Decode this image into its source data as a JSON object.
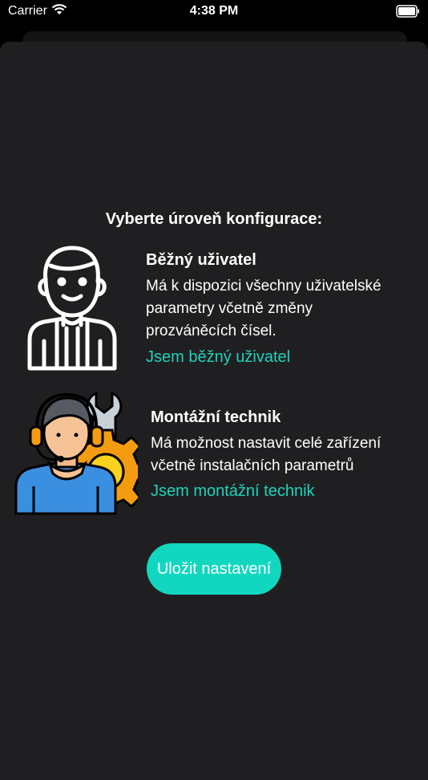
{
  "status": {
    "carrier": "Carrier",
    "time": "4:38 PM"
  },
  "heading": "Vyberte úroveň konfigurace:",
  "options": [
    {
      "title": "Běžný uživatel",
      "description": [
        "Má k dispozici všechny uživatelské",
        "parametry včetně změny",
        "prozváněcích čísel."
      ],
      "link": "Jsem běžný uživatel"
    },
    {
      "title": "Montážní technik",
      "description": [
        "Má možnost nastavit celé zařízení",
        "včetně instalačních parametrů"
      ],
      "link": "Jsem montážní technik"
    }
  ],
  "save_label": "Uložit nastavení",
  "colors": {
    "accent": "#11d7c0",
    "link": "#1dd4bd",
    "sheet": "#1f1f21"
  },
  "icons": [
    "wifi-icon",
    "battery-icon",
    "user-avatar-icon",
    "technician-icon"
  ]
}
